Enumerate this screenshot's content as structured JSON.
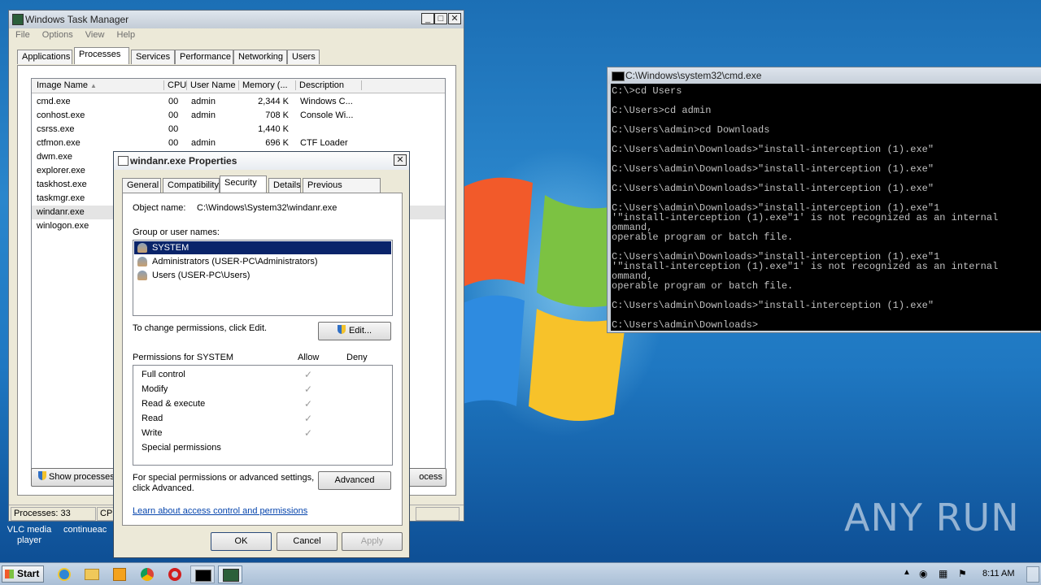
{
  "taskmgr": {
    "title": "Windows Task Manager",
    "menu": [
      "File",
      "Options",
      "View",
      "Help"
    ],
    "tabs": [
      "Applications",
      "Processes",
      "Services",
      "Performance",
      "Networking",
      "Users"
    ],
    "columns": [
      "Image Name",
      "CPU",
      "User Name",
      "Memory (...",
      "Description"
    ],
    "rows": [
      [
        "cmd.exe",
        "00",
        "admin",
        "2,344 K",
        "Windows C..."
      ],
      [
        "conhost.exe",
        "00",
        "admin",
        "708 K",
        "Console Wi..."
      ],
      [
        "csrss.exe",
        "00",
        "",
        "1,440 K",
        ""
      ],
      [
        "ctfmon.exe",
        "00",
        "admin",
        "696 K",
        "CTF Loader"
      ],
      [
        "dwm.exe",
        "",
        "",
        "",
        ""
      ],
      [
        "explorer.exe",
        "",
        "",
        "",
        ""
      ],
      [
        "taskhost.exe",
        "",
        "",
        "",
        ""
      ],
      [
        "taskmgr.exe",
        "",
        "",
        "",
        ""
      ],
      [
        "windanr.exe",
        "",
        "",
        "",
        ""
      ],
      [
        "winlogon.exe",
        "",
        "",
        "",
        ""
      ]
    ],
    "show_processes_label": "Show processes",
    "end_process_label": "ocess",
    "status_processes": "Processes: 33",
    "status_cpu": "CPU"
  },
  "props": {
    "title": "windanr.exe Properties",
    "tabs": [
      "General",
      "Compatibility",
      "Security",
      "Details",
      "Previous Versions"
    ],
    "object_label": "Object name:",
    "object_value": "C:\\Windows\\System32\\windanr.exe",
    "group_label": "Group or user names:",
    "groups": [
      "SYSTEM",
      "Administrators (USER-PC\\Administrators)",
      "Users (USER-PC\\Users)"
    ],
    "change_text": "To change permissions, click Edit.",
    "edit_label": "Edit...",
    "perm_title": "Permissions for SYSTEM",
    "allow": "Allow",
    "deny": "Deny",
    "perms": [
      "Full control",
      "Modify",
      "Read & execute",
      "Read",
      "Write",
      "Special permissions"
    ],
    "perm_allowed": [
      true,
      true,
      true,
      true,
      true,
      false
    ],
    "special_text_1": "For special permissions or advanced settings,",
    "special_text_2": "click Advanced.",
    "advanced_label": "Advanced",
    "learn_link": "Learn about access control and permissions",
    "ok": "OK",
    "cancel": "Cancel",
    "apply": "Apply"
  },
  "cmd": {
    "title": "C:\\Windows\\system32\\cmd.exe",
    "lines": [
      "C:\\>cd Users",
      "",
      "C:\\Users>cd admin",
      "",
      "C:\\Users\\admin>cd Downloads",
      "",
      "C:\\Users\\admin\\Downloads>\"install-interception (1).exe\"",
      "",
      "C:\\Users\\admin\\Downloads>\"install-interception (1).exe\"",
      "",
      "C:\\Users\\admin\\Downloads>\"install-interception (1).exe\"",
      "",
      "C:\\Users\\admin\\Downloads>\"install-interception (1).exe\"1",
      "'\"install-interception (1).exe\"1' is not recognized as an internal",
      "ommand,",
      "operable program or batch file.",
      "",
      "C:\\Users\\admin\\Downloads>\"install-interception (1).exe\"1",
      "'\"install-interception (1).exe\"1' is not recognized as an internal",
      "ommand,",
      "operable program or batch file.",
      "",
      "C:\\Users\\admin\\Downloads>\"install-interception (1).exe\"",
      "",
      "C:\\Users\\admin\\Downloads>"
    ]
  },
  "desktop": {
    "icon1": "VLC media player",
    "icon2": "continueac",
    "watermark": "ANY RUN"
  },
  "taskbar": {
    "start": "Start",
    "clock": "8:11 AM"
  }
}
